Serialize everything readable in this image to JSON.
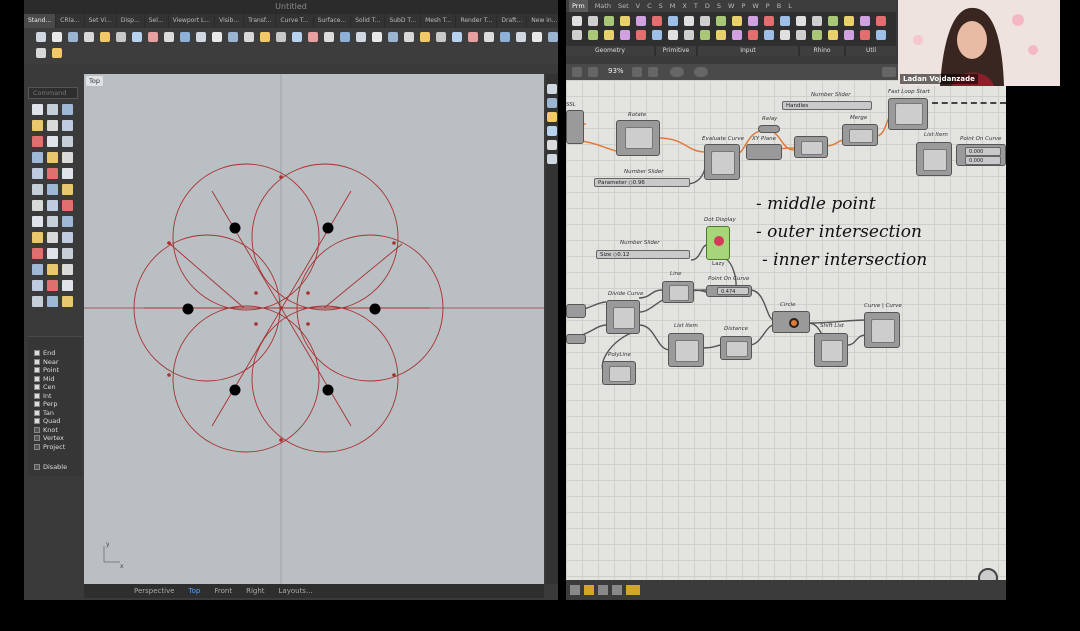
{
  "rhino": {
    "window_title": "Untitled",
    "tabs": [
      "Stand...",
      "CRla...",
      "Set Vi...",
      "Disp...",
      "Sel...",
      "Viewport L...",
      "Visib...",
      "Transf...",
      "Curve T...",
      "Surface...",
      "Solid T...",
      "SubD T...",
      "Mesh T...",
      "Render T...",
      "Draft...",
      "New in..."
    ],
    "command_placeholder": "Command",
    "viewport_label": "Top",
    "viewport_tabs": [
      "Perspective",
      "Top",
      "Front",
      "Right",
      "Layouts..."
    ],
    "active_viewport": "Top",
    "osnaps": [
      {
        "label": "End",
        "checked": true
      },
      {
        "label": "Near",
        "checked": true
      },
      {
        "label": "Point",
        "checked": true
      },
      {
        "label": "Mid",
        "checked": true
      },
      {
        "label": "Cen",
        "checked": true
      },
      {
        "label": "Int",
        "checked": true
      },
      {
        "label": "Perp",
        "checked": true
      },
      {
        "label": "Tan",
        "checked": true
      },
      {
        "label": "Quad",
        "checked": true
      },
      {
        "label": "Knot",
        "checked": false
      },
      {
        "label": "Vertex",
        "checked": false
      },
      {
        "label": "Project",
        "checked": false
      },
      {
        "label": "Disable",
        "checked": false
      }
    ],
    "axis_y": "y",
    "axis_x": "x"
  },
  "grasshopper": {
    "tabs": [
      "Prm",
      "Math",
      "Set",
      "V",
      "C",
      "S",
      "M",
      "X",
      "T",
      "D",
      "S",
      "W",
      "P",
      "W",
      "P",
      "B",
      "L"
    ],
    "active_tab": "Prm",
    "categories": [
      "Geometry",
      "Primitive",
      "Input",
      "Rhino",
      "Util"
    ],
    "zoom": "93%",
    "nodes": {
      "number_slider_top": "Number Slider",
      "number_slider_top_label": "Handles",
      "rotate": "Rotate",
      "relay": "Relay",
      "xy_plane": "XY Plane",
      "evaluate_curve": "Evaluate Curve",
      "merge": "Merge",
      "fast_loop": "Fast Loop Start",
      "list_item_top": "List Item",
      "point_on_curve_top": "Point On Curve",
      "point_on_curve_top_val1": "0.000",
      "point_on_curve_top_val2": "0.000",
      "number_slider_mid": "Number Slider",
      "number_slider_mid_label": "Parameter",
      "number_slider_mid_value": "0.96",
      "dot_display": "Dot Display",
      "dot_display_footer": "Lazy",
      "number_slider_size": "Number Slider",
      "size_label": "Size",
      "size_value": "0.12",
      "line": "Line",
      "divide_curve": "Divide Curve",
      "point_on_curve": "Point On Curve",
      "point_on_curve_value": "0.474",
      "circle": "Circle",
      "curve_curve": "Curve | Curve",
      "list_item": "List Item",
      "distance": "Distance",
      "shift_list": "Shift List",
      "polyline": "PolyLine",
      "ssl": "SSL"
    },
    "notes": [
      "- middle point",
      "- outer intersection",
      "- inner intersection"
    ]
  },
  "webcam": {
    "name": "Ladan Vojdanzade"
  },
  "colors": {
    "curve": "#a83030",
    "viewport_bg": "#b9bfc3",
    "canvas_bg": "#e3e3e0",
    "wire": "#e07a3a"
  }
}
